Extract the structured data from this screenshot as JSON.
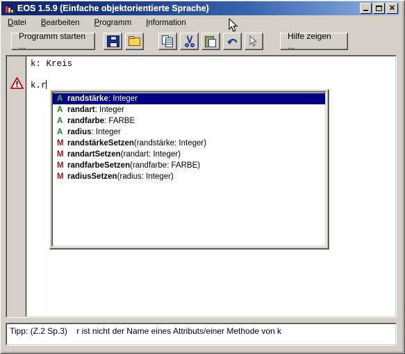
{
  "window": {
    "title": "EOS 1.5.9 (Einfache objektorientierte Sprache)",
    "app_icon": "eos-bars-icon",
    "controls": {
      "minimize": "_",
      "maximize": "□",
      "close": "✕"
    },
    "colors": {
      "title_gradient_start": "#0a246a",
      "title_gradient_end": "#a6c0e8",
      "face": "#d4d0c8",
      "selection": "#000080",
      "attribute_marker": "#108010",
      "method_marker": "#8b1a1a",
      "warning": "#d80000"
    }
  },
  "menubar": {
    "items": [
      {
        "label": "Datei",
        "mnemonic": "D"
      },
      {
        "label": "Bearbeiten",
        "mnemonic": "B"
      },
      {
        "label": "Programm",
        "mnemonic": "P"
      },
      {
        "label": "Information",
        "mnemonic": "I"
      }
    ]
  },
  "toolbar": {
    "start_label": "Programm starten ...",
    "help_label": "Hilfe zeigen ...",
    "icons": [
      {
        "name": "save-icon"
      },
      {
        "name": "open-folder-icon"
      },
      {
        "name": "copy-icon"
      },
      {
        "name": "cut-scissors-icon"
      },
      {
        "name": "paste-icon"
      },
      {
        "name": "undo-arrow-icon"
      },
      {
        "name": "pointer-select-icon"
      }
    ]
  },
  "editor": {
    "line1": "k: Kreis",
    "line2_blank": "",
    "line3": "k.r",
    "warning_marker": "warning-triangle-icon"
  },
  "autocomplete": {
    "items": [
      {
        "kind": "A",
        "kind_type": "attr",
        "name": "randstärke",
        "rest": ": Integer",
        "selected": true
      },
      {
        "kind": "A",
        "kind_type": "attr",
        "name": "randart",
        "rest": ": Integer",
        "selected": false
      },
      {
        "kind": "A",
        "kind_type": "attr",
        "name": "randfarbe",
        "rest": ": FARBE",
        "selected": false
      },
      {
        "kind": "A",
        "kind_type": "attr",
        "name": "radius",
        "rest": ": Integer",
        "selected": false
      },
      {
        "kind": "M",
        "kind_type": "meth",
        "name": "randstärkeSetzen",
        "rest": "(randstärke: Integer)",
        "selected": false
      },
      {
        "kind": "M",
        "kind_type": "meth",
        "name": "randartSetzen",
        "rest": "(randart: Integer)",
        "selected": false
      },
      {
        "kind": "M",
        "kind_type": "meth",
        "name": "randfarbeSetzen",
        "rest": "(randfarbe: FARBE)",
        "selected": false
      },
      {
        "kind": "M",
        "kind_type": "meth",
        "name": "radiusSetzen",
        "rest": "(radius: Integer)",
        "selected": false
      }
    ]
  },
  "statusbar": {
    "text": "Tipp: (Z.2 Sp.3)    r ist nicht der Name eines Attributs/einer Methode von k"
  }
}
